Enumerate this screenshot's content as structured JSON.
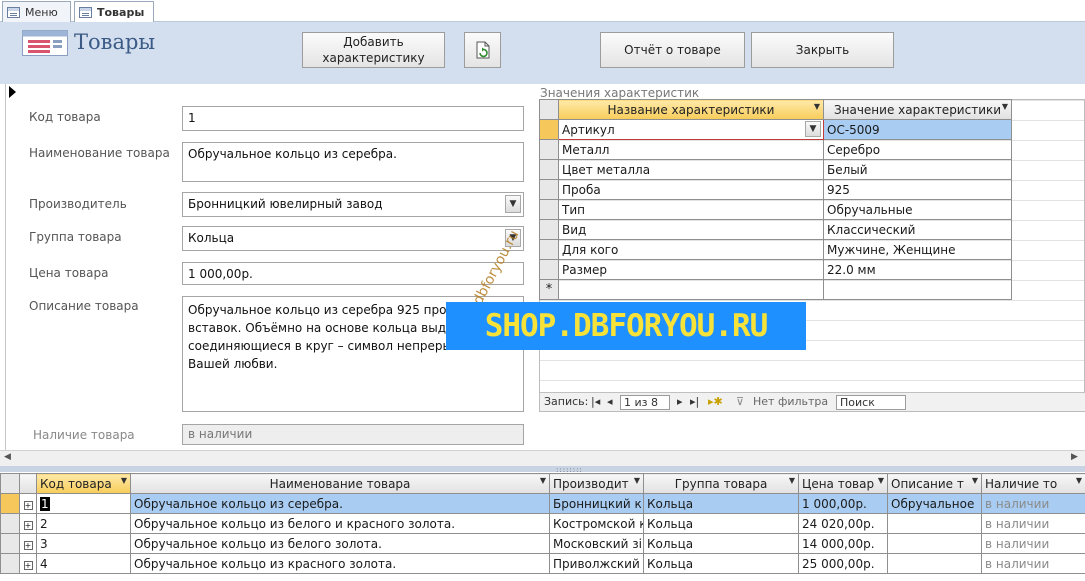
{
  "tabs": [
    {
      "label": "Меню",
      "active": false
    },
    {
      "label": "Товары",
      "active": true
    }
  ],
  "header": {
    "title": "Товары",
    "buttons": {
      "add_characteristic": "Добавить характеристику",
      "report": "Отчёт о товаре",
      "close": "Закрыть"
    },
    "refresh_icon": "refresh-document-icon"
  },
  "form": {
    "code": {
      "label": "Код товара",
      "value": "1"
    },
    "name": {
      "label": "Наименование товара",
      "value": "Обручальное кольцо из серебра."
    },
    "manufacturer": {
      "label": "Производитель",
      "value": "Бронницкий ювелирный завод"
    },
    "group": {
      "label": "Группа товара",
      "value": "Кольца"
    },
    "price": {
      "label": "Цена товара",
      "value": "1 000,00р."
    },
    "description": {
      "label": "Описание товара",
      "value": "Обручальное кольцо из серебра 925 пробы без вставок. Объёмно на основе кольца выд линии, соединяющиеся в круг – символ непрерывности Вашей любви."
    },
    "availability": {
      "label": "Наличие товара",
      "value": "в наличии"
    }
  },
  "subform": {
    "caption": "Значения характеристик",
    "columns": [
      "Название характеристики",
      "Значение характеристики"
    ],
    "rows": [
      {
        "name": "Артикул",
        "value": "ОС-5009"
      },
      {
        "name": "Металл",
        "value": "Серебро"
      },
      {
        "name": "Цвет металла",
        "value": "Белый"
      },
      {
        "name": "Проба",
        "value": "925"
      },
      {
        "name": "Тип",
        "value": "Обручальные"
      },
      {
        "name": "Вид",
        "value": "Классический"
      },
      {
        "name": "Для кого",
        "value": "Мужчине, Женщине"
      },
      {
        "name": "Размер",
        "value": "22.0 мм"
      }
    ],
    "new_row_marker": "*",
    "nav": {
      "label": "Запись:",
      "position": "1 из 8",
      "filter": "Нет фильтра",
      "search": "Поиск"
    }
  },
  "watermark": {
    "main": "SHOP.DBFORYOU.RU",
    "diagonal": "dbforyou.ru"
  },
  "datasheet": {
    "columns": [
      "Код товара",
      "Наименование товара",
      "Производит",
      "Группа товара",
      "Цена товар",
      "Описание т",
      "Наличие то"
    ],
    "rows": [
      {
        "code": "1",
        "name": "Обручальное кольцо из серебра.",
        "maker": "Бронницкий к",
        "group": "Кольца",
        "price": "1 000,00р.",
        "desc": "Обручальное",
        "avail": "в наличии"
      },
      {
        "code": "2",
        "name": "Обручальное кольцо из белого и красного золота.",
        "maker": "Костромской к",
        "group": "Кольца",
        "price": "24 020,00р.",
        "desc": "",
        "avail": "в наличии"
      },
      {
        "code": "3",
        "name": "Обручальное кольцо из белого золота.",
        "maker": "Московский зі",
        "group": "Кольца",
        "price": "14 000,00р.",
        "desc": "",
        "avail": "в наличии"
      },
      {
        "code": "4",
        "name": "Обручальное кольцо из красного золота.",
        "maker": "Приволжский",
        "group": "Кольца",
        "price": "25 000,00р.",
        "desc": "",
        "avail": "в наличии"
      }
    ]
  }
}
